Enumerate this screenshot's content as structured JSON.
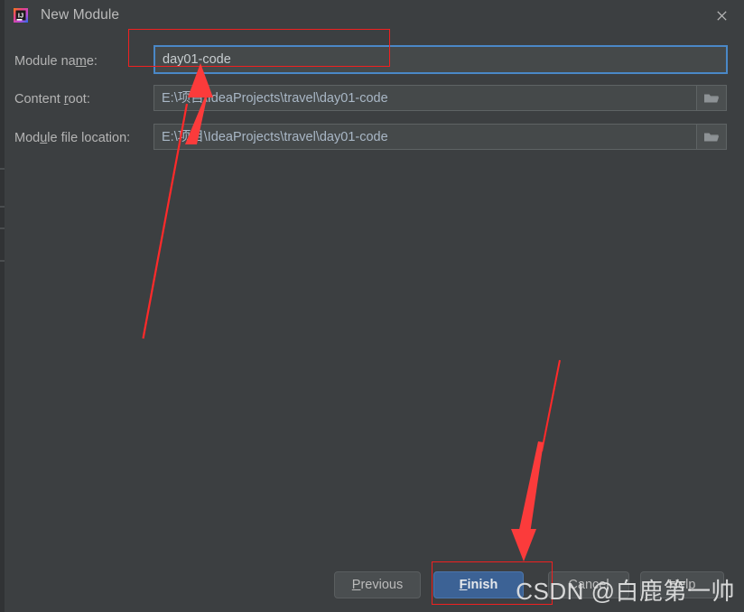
{
  "window": {
    "title": "New Module",
    "app_icon": "intellij-idea-icon",
    "close_icon": "close-icon",
    "background_color": "#3c3f41"
  },
  "form": {
    "rows": [
      {
        "label_before": "Module na",
        "label_mnemonic": "m",
        "label_after": "e:",
        "name": "module-name",
        "value": "day01-code",
        "focused": true,
        "has_browse": false
      },
      {
        "label_before": "Content ",
        "label_mnemonic": "r",
        "label_after": "oot:",
        "name": "content-root",
        "value": "E:\\项目\\IdeaProjects\\travel\\day01-code",
        "focused": false,
        "has_browse": true,
        "browse_icon": "folder-icon"
      },
      {
        "label_before": "Mod",
        "label_mnemonic": "u",
        "label_after": "le file location:",
        "name": "module-file-location",
        "value": "E:\\项目\\IdeaProjects\\travel\\day01-code",
        "focused": false,
        "has_browse": true,
        "browse_icon": "folder-icon"
      }
    ]
  },
  "buttons": {
    "previous": {
      "before": "",
      "mnemonic": "P",
      "after": "revious"
    },
    "finish": {
      "before": "",
      "mnemonic": "F",
      "after": "inish"
    },
    "cancel": {
      "before": "Cancel",
      "mnemonic": "",
      "after": ""
    },
    "help": {
      "before": "Help",
      "mnemonic": "",
      "after": ""
    }
  },
  "annotations": {
    "color": "#f02020",
    "box_module_name": "highlight-module-name-field",
    "box_finish": "highlight-finish-button",
    "arrow_module_name": "arrow-pointing-to-module-name",
    "arrow_finish": "arrow-pointing-to-finish"
  },
  "watermark": {
    "text": "CSDN @白鹿第一帅"
  }
}
